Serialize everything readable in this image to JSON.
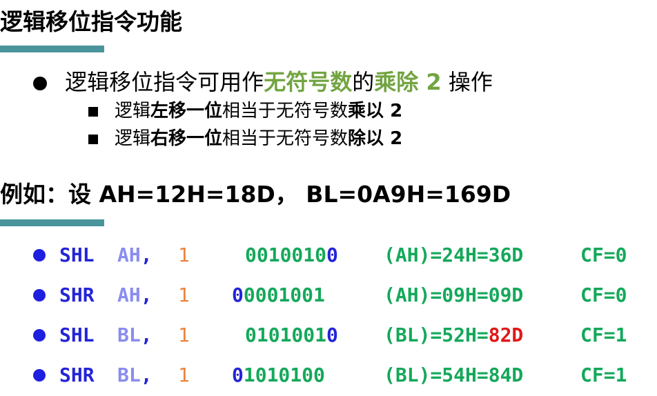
{
  "title": "逻辑移位指令功能",
  "main_bullet": {
    "pre": "逻辑移位指令可用作",
    "hl1": "无符号数",
    "mid": "的",
    "hl2": "乘除 2",
    "post": " 操作"
  },
  "sub_bullets": [
    {
      "a": "逻辑",
      "b": "左移一位",
      "c": "相当于无符号数",
      "d": "乘以 2"
    },
    {
      "a": "逻辑",
      "b": "右移一位",
      "c": "相当于无符号数",
      "d": "除以 2"
    }
  ],
  "example": "例如：设 AH=12H=18D， BL=0A9H=169D",
  "rows": [
    {
      "instr": "SHL",
      "reg": "AH",
      "comma": ",",
      "count": "1",
      "bits_first": "",
      "bits_mid": "0010010",
      "bits_last": "0",
      "res_a": "(AH)=24H=",
      "res_b": "36D",
      "res_b_red": false,
      "cf": "CF=0"
    },
    {
      "instr": "SHR",
      "reg": "AH",
      "comma": ",",
      "count": "1",
      "bits_first": "0",
      "bits_mid": "0001001",
      "bits_last": "",
      "res_a": "(AH)=09H=",
      "res_b": "09D",
      "res_b_red": false,
      "cf": "CF=0"
    },
    {
      "instr": "SHL",
      "reg": "BL",
      "comma": ",",
      "count": "1",
      "bits_first": "",
      "bits_mid": "0101001",
      "bits_last": "0",
      "res_a": "(BL)=52H=",
      "res_b": "82D",
      "res_b_red": true,
      "cf": "CF=1"
    },
    {
      "instr": "SHR",
      "reg": "BL",
      "comma": ",",
      "count": "1",
      "bits_first": "0",
      "bits_mid": "1010100",
      "bits_last": "",
      "res_a": "(BL)=54H=",
      "res_b": "84D",
      "res_b_red": false,
      "cf": "CF=1"
    }
  ],
  "colors": {
    "rule": "#4a959b",
    "highlight": "#72a441",
    "instr": "#2424d8",
    "reg": "#8a8cf0",
    "count": "#e8853c",
    "bits": "#14a85a",
    "alert": "#e01818"
  }
}
